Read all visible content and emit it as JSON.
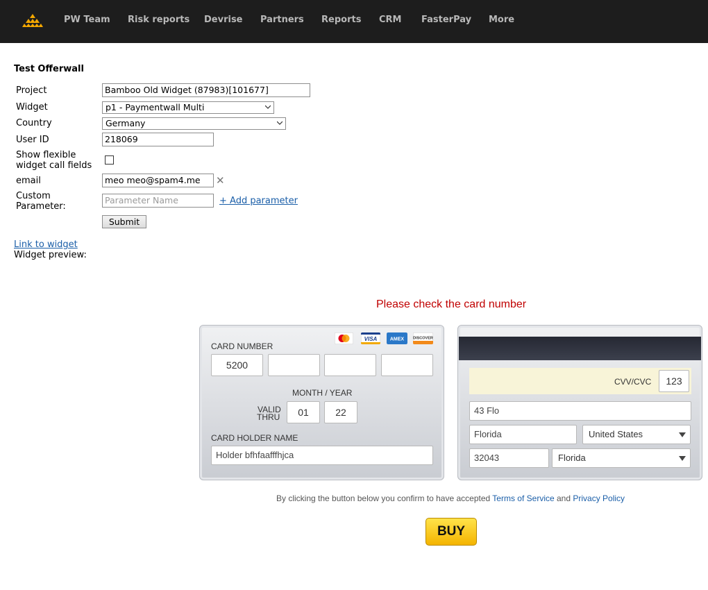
{
  "nav": {
    "items": [
      "PW Team",
      "Risk reports",
      "Devrise",
      "Partners",
      "Reports",
      "CRM",
      "FasterPay",
      "More"
    ]
  },
  "form": {
    "title": "Test Offerwall",
    "project_label": "Project",
    "project_value": "Bamboo Old Widget (87983)[101677]",
    "widget_label": "Widget",
    "widget_value": "p1 - Paymentwall Multi",
    "country_label": "Country",
    "country_value": "Germany",
    "user_id_label": "User ID",
    "user_id_value": "218069",
    "flexible_label_1": "Show flexible",
    "flexible_label_2": "widget call fields",
    "email_label": "email",
    "email_value": "meo meo@spam4.me",
    "custom_label_1": "Custom",
    "custom_label_2": "Parameter:",
    "param_placeholder": "Parameter Name",
    "add_param_link": "+ Add parameter",
    "submit_label": "Submit",
    "link_to_widget": "Link to widget",
    "widget_preview_label": "Widget preview:"
  },
  "widget": {
    "error_message": "Please check the card number",
    "card_number_label": "CARD NUMBER",
    "card_number_parts": [
      "5200",
      "",
      "",
      ""
    ],
    "month_year_label": "MONTH / YEAR",
    "valid_thru_1": "VALID",
    "valid_thru_2": "THRU",
    "month": "01",
    "year": "22",
    "holder_label": "CARD HOLDER NAME",
    "holder_value": "Holder bfhfaafffhjca",
    "brands": [
      "mastercard-icon",
      "visa-icon",
      "amex-icon",
      "discover-icon"
    ],
    "cvv_label": "CVV/CVC",
    "cvv_value": "123",
    "address": "43 Flo",
    "city": "Florida",
    "country": "United States",
    "zip": "32043",
    "state": "Florida",
    "terms_prefix": "By clicking the button below you confirm to have accepted ",
    "terms_link": "Terms of Service",
    "terms_and": " and ",
    "privacy_link": "Privacy Policy",
    "buy_label": "BUY"
  },
  "colors": {
    "nav_bg": "#1d1d1d",
    "error": "#c00000",
    "link": "#1a5ea8",
    "buy": "#f4b400"
  }
}
